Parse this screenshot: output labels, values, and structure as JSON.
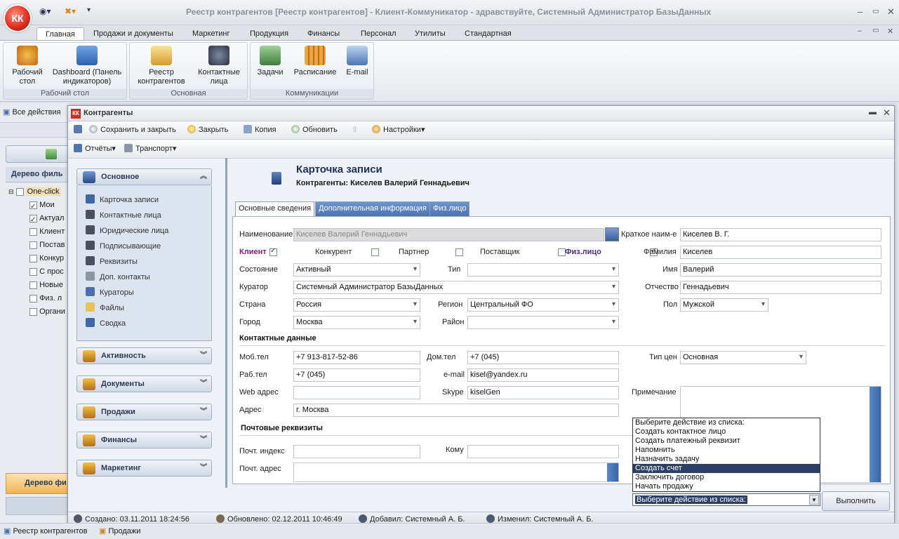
{
  "app": {
    "logo_text": "КК",
    "window_title": "Реестр контрагентов [Реестр контрагентов] - Клиент-Коммуникатор - здравствуйте, Системный Администратор БазыДанных"
  },
  "ribbon_tabs": [
    "Главная",
    "Продажи и документы",
    "Маркетинг",
    "Продукция",
    "Финансы",
    "Персонал",
    "Утилиты",
    "Стандартная"
  ],
  "ribbon_groups": [
    {
      "label": "Рабочий стол",
      "buttons": [
        {
          "label": "Рабочий стол",
          "icon": "gears-icon"
        },
        {
          "label": "Dashboard (Панель индикаторов)",
          "icon": "dashboard-icon"
        }
      ]
    },
    {
      "label": "Основная",
      "buttons": [
        {
          "label": "Реестр контрагентов",
          "icon": "house-icon"
        },
        {
          "label": "Контактные лица",
          "icon": "people-icon"
        }
      ]
    },
    {
      "label": "Коммуникации",
      "buttons": [
        {
          "label": "Задачи",
          "icon": "tasks-icon"
        },
        {
          "label": "Расписание",
          "icon": "calendar-icon"
        },
        {
          "label": "E-mail",
          "icon": "mail-icon"
        }
      ]
    }
  ],
  "background": {
    "all_actions": "Все действия",
    "filter_tree_header": "Дерево филь",
    "tree": [
      {
        "label": "One-click",
        "checked": false,
        "level": 0
      },
      {
        "label": "Мои",
        "checked": true,
        "level": 1
      },
      {
        "label": "Актуал",
        "checked": true,
        "level": 1
      },
      {
        "label": "Клиент",
        "checked": false,
        "level": 1
      },
      {
        "label": "Постав",
        "checked": false,
        "level": 1
      },
      {
        "label": "Конкур",
        "checked": false,
        "level": 1
      },
      {
        "label": "С прос",
        "checked": false,
        "level": 1
      },
      {
        "label": "Новые",
        "checked": false,
        "level": 1
      },
      {
        "label": "Физ. л",
        "checked": false,
        "level": 1
      },
      {
        "label": "Органи",
        "checked": false,
        "level": 1
      }
    ],
    "bottom_label": "Дерево фи"
  },
  "dialog": {
    "title": "Контрагенты",
    "toolbar": {
      "save_close": "Сохранить и закрыть",
      "close": "Закрыть",
      "copy": "Копия",
      "refresh": "Обновить",
      "settings": "Настройки",
      "reports": "Отчёты",
      "transport": "Транспорт"
    },
    "nav": {
      "main_header": "Основное",
      "items": [
        "Карточка записи",
        "Контактные лица",
        "Юридические лица",
        "Подписывающие",
        "Реквизиты",
        "Доп. контакты",
        "Кураторы",
        "Файлы",
        "Сводка"
      ],
      "groups": [
        "Активность",
        "Документы",
        "Продажи",
        "Финансы",
        "Маркетинг"
      ]
    },
    "card": {
      "title": "Карточка записи",
      "subtitle": "Контрагенты: Киселев Валерий Геннадьевич"
    },
    "tabs": [
      "Основные сведения",
      "Дополнительная информация",
      "Физ.лицо"
    ],
    "form": {
      "name_label": "Наименование",
      "name_value": "Киселев Валерий Геннадьевич",
      "short_name_label": "Краткое наим-е",
      "short_name_value": "Киселев В. Г.",
      "client_label": "Клиент",
      "competitor_label": "Конкурент",
      "partner_label": "Партнер",
      "supplier_label": "Поставщик",
      "individual_label": "Физ.лицо",
      "surname_label": "Фамилия",
      "surname_value": "Киселев",
      "state_label": "Состояние",
      "state_value": "Активный",
      "type_label": "Тип",
      "type_value": "",
      "firstname_label": "Имя",
      "firstname_value": "Валерий",
      "curator_label": "Куратор",
      "curator_value": "Системный Администратор БазыДанных",
      "patronymic_label": "Отчество",
      "patronymic_value": "Геннадьевич",
      "country_label": "Страна",
      "country_value": "Россия",
      "region_label": "Регион",
      "region_value": "Центральный ФО",
      "gender_label": "Пол",
      "gender_value": "Мужской",
      "city_label": "Город",
      "city_value": "Москва",
      "district_label": "Район",
      "district_value": "",
      "contacts_section": "Контактные данные",
      "mobile_label": "Моб.тел",
      "mobile_value": "+7 913-817-52-86",
      "home_label": "Дом.тел",
      "home_value": "+7 (045)",
      "price_type_label": "Тип цен",
      "price_type_value": "Основная",
      "work_label": "Раб.тел",
      "work_value": "+7 (045)",
      "email_label": "e-mail",
      "email_value": "kisel@yandex.ru",
      "web_label": "Web адрес",
      "web_value": "",
      "skype_label": "Skype",
      "skype_value": "kiselGen",
      "note_label": "Примечание",
      "address_label": "Адрес",
      "address_value": "г. Москва",
      "postal_section": "Почтовые реквизиты",
      "zip_label": "Почт. индекс",
      "zip_value": "",
      "to_label": "Кому",
      "to_value": "",
      "post_address_label": "Почт. адрес",
      "post_address_value": ""
    },
    "actions": {
      "options": [
        "Выберите действие из списка:",
        "Создать контактное лицо",
        "Создать платежный реквизит",
        "Напомнить",
        "Назначить задачу",
        "Создать счет",
        "Заключить договор",
        "Начать продажу"
      ],
      "highlighted": "Создать счет",
      "selected": "Выберите действие из списка:",
      "run_label": "Выполнить"
    },
    "status": {
      "created": "Создано: 03.11.2011 18:24:56",
      "updated": "Обновлено: 02.12.2011 10:46:49",
      "added": "Добавил: Системный А. Б.",
      "changed": "Изменил: Системный А. Б."
    }
  },
  "taskbar": [
    "Реестр контрагентов",
    "Продажи"
  ]
}
